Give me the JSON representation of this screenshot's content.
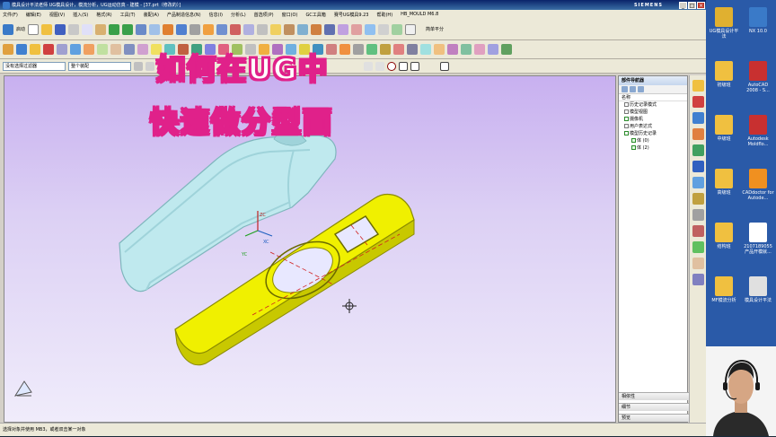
{
  "window": {
    "title": "模具设计平法老师 UG模具设计，模流分析，UG运动仿真 - 建模 - [37.prt（修改的）]",
    "brand": "SIEMENS",
    "controls": [
      "_",
      "□",
      "×"
    ]
  },
  "menu": [
    "文件(F)",
    "编辑(E)",
    "视图(V)",
    "插入(S)",
    "格式(R)",
    "工具(T)",
    "装配(A)",
    "产品制造信息(N)",
    "信息(I)",
    "分析(L)",
    "首选项(P)",
    "窗口(O)",
    "GC工具箱",
    "赛号UG模具9.23",
    "帮助(H)",
    "HB_MOULD M6.8"
  ],
  "toolbar": {
    "start_label": "启动",
    "right_label": "简单平分",
    "selection_filter": "没有选择过滤器",
    "assembly_scope": "整个装配"
  },
  "overlay": {
    "line1": "如何在UG中",
    "line2": "快速做分型面"
  },
  "viewport": {
    "xc_label": "XC",
    "yc_label": "YC",
    "zc_label": "ZC",
    "parts": [
      {
        "name": "upper-cover",
        "color": "#bfe9ee"
      },
      {
        "name": "lower-base",
        "color": "#f0f000"
      }
    ]
  },
  "navigator": {
    "title": "部件导航器",
    "column": "名称",
    "nodes": [
      {
        "label": "历史记录模式",
        "indent": 0
      },
      {
        "label": "模型视图",
        "indent": 0
      },
      {
        "label": "摄像机",
        "indent": 0
      },
      {
        "label": "用户表达式",
        "indent": 0
      },
      {
        "label": "模型历史记录",
        "indent": 0
      },
      {
        "label": "体 (0)",
        "indent": 1
      },
      {
        "label": "体 (2)",
        "indent": 1
      }
    ],
    "footer": [
      "相依性",
      "细节",
      "预览"
    ]
  },
  "status": {
    "text": "选择对象并使用 MB3，或者双击某一对象"
  },
  "desktop": {
    "icons": [
      {
        "label": "UG模具设计平法",
        "color": "#e0b030"
      },
      {
        "label": "NX 10.0",
        "color": "#3a7ac8"
      },
      {
        "label": "初级班",
        "color": "#f0c040"
      },
      {
        "label": "AutoCAD 2008 - S...",
        "color": "#c83030"
      },
      {
        "label": "中级班",
        "color": "#f0c040"
      },
      {
        "label": "Autodesk Moldflo...",
        "color": "#c83030"
      },
      {
        "label": "高级班",
        "color": "#f0c040"
      },
      {
        "label": "CADdoctor for Autode...",
        "color": "#f09020"
      },
      {
        "label": "结构班",
        "color": "#f0c040"
      },
      {
        "label": "2107189055 产品开模就...",
        "color": "#ffffff"
      },
      {
        "label": "MF模流分析",
        "color": "#f0c040"
      },
      {
        "label": "模具设计平法",
        "color": "#e0e0e0"
      }
    ]
  },
  "colors": {
    "accent": "#e0218a",
    "viewport_top": "#c8b0f0",
    "part_cyan": "#bfe9ee",
    "part_yellow": "#f0f000"
  }
}
